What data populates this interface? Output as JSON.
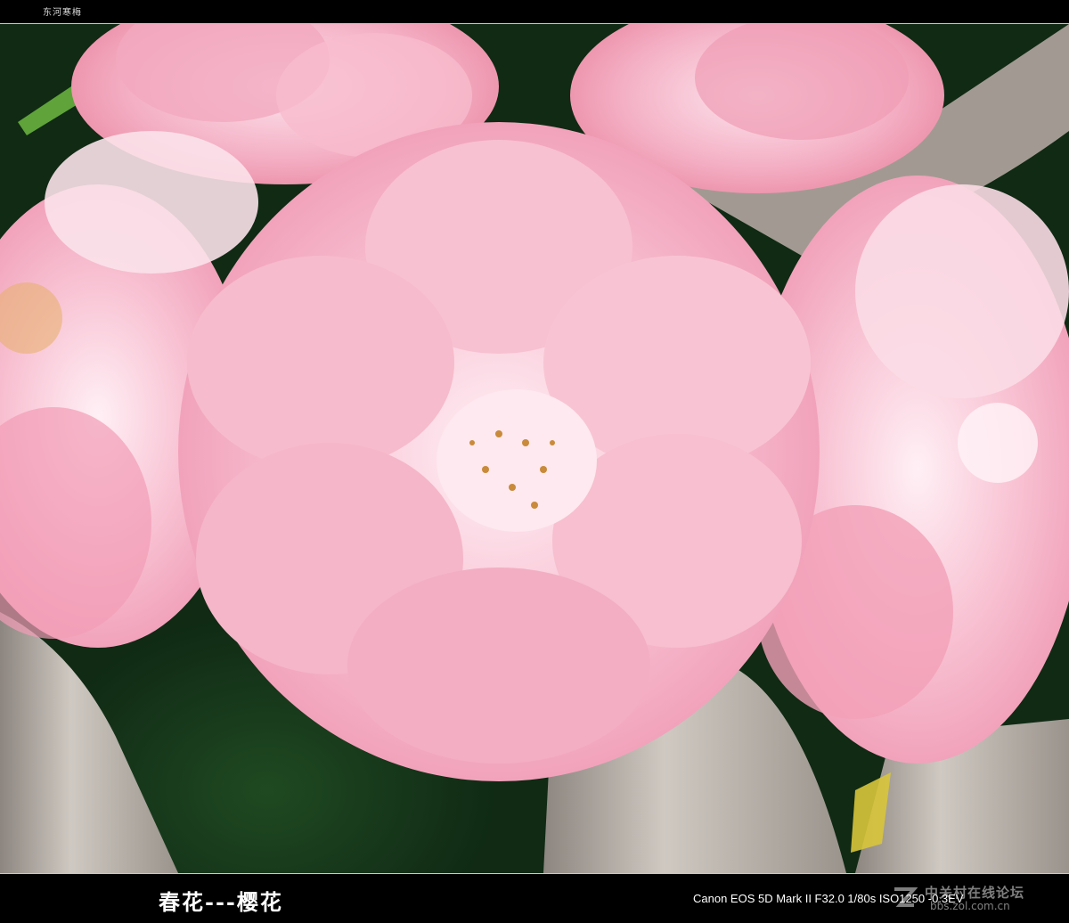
{
  "header": {
    "label": "东河寒梅"
  },
  "photo": {
    "subject": "pink double cherry blossoms on a branch"
  },
  "footer": {
    "caption": "春花---樱花",
    "exif": "Canon EOS 5D Mark II F32.0 1/80s ISO1250 -0.3EV"
  },
  "watermark": {
    "title": "中关村在线论坛",
    "url": "bbs.zol.com.cn"
  },
  "colors": {
    "petal_light": "#fbd3e0",
    "petal_mid": "#f6b5c9",
    "petal_deep": "#ee93af",
    "bark": "#b8b0a8",
    "leaf_bg": "#1a3a1c"
  }
}
